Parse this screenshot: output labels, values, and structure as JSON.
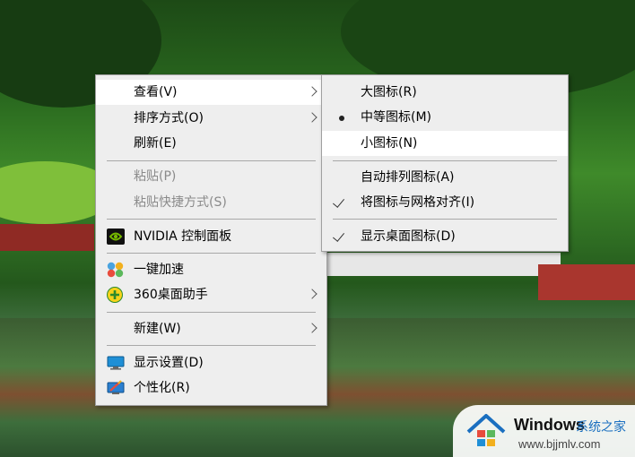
{
  "main_menu": {
    "view": "查看(V)",
    "sort_by": "排序方式(O)",
    "refresh": "刷新(E)",
    "paste": "粘贴(P)",
    "paste_shortcut": "粘贴快捷方式(S)",
    "nvidia": "NVIDIA 控制面板",
    "speed_up": "一键加速",
    "desktop_helper": "360桌面助手",
    "new": "新建(W)",
    "display_settings": "显示设置(D)",
    "personalize": "个性化(R)"
  },
  "view_submenu": {
    "large_icons": "大图标(R)",
    "medium_icons": "中等图标(M)",
    "small_icons": "小图标(N)",
    "auto_arrange": "自动排列图标(A)",
    "align_to_grid": "将图标与网格对齐(I)",
    "show_desktop_icons": "显示桌面图标(D)",
    "selected_size": "中等图标(M)",
    "align_to_grid_checked": true,
    "show_desktop_icons_checked": true
  },
  "watermark": {
    "brand": "Windows",
    "brand_suffix": "系统之家",
    "url": "www.bjjmlv.com"
  },
  "colors": {
    "menu_bg": "#eeeeee",
    "menu_highlight": "#ffffff",
    "disabled_text": "#8a8a8a",
    "watermark_accent": "#1a6fc0"
  }
}
